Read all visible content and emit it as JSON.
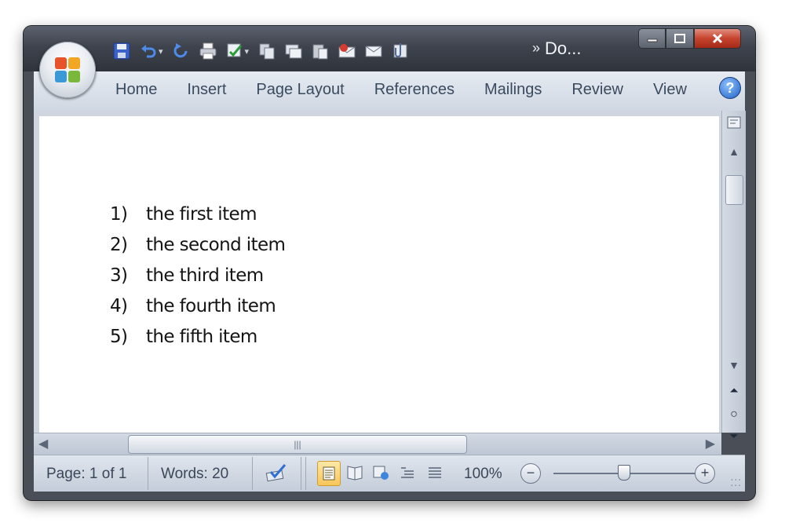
{
  "window": {
    "title": "Do..."
  },
  "quick_access": {
    "icons": [
      "save-icon",
      "undo-icon",
      "redo-icon",
      "quick-print-icon",
      "spelling-icon",
      "copy-icon",
      "new-comment-icon",
      "paste-icon",
      "email-icon",
      "envelope-icon",
      "attach-icon"
    ],
    "overflow": "»"
  },
  "ribbon": {
    "tabs": [
      "Home",
      "Insert",
      "Page Layout",
      "References",
      "Mailings",
      "Review",
      "View"
    ],
    "help": "?"
  },
  "document": {
    "list": [
      {
        "num": "1)",
        "text": "the first item"
      },
      {
        "num": "2)",
        "text": "the second item"
      },
      {
        "num": "3)",
        "text": "the third item"
      },
      {
        "num": "4)",
        "text": "the fourth item"
      },
      {
        "num": "5)",
        "text": "the fifth item"
      }
    ]
  },
  "status": {
    "page": "Page: 1 of 1",
    "words": "Words: 20",
    "zoom": "100%",
    "zoom_fraction": 0.5
  },
  "colors": {
    "title_bar": "#3e434d",
    "ribbon": "#dde3eb",
    "active_view": "#f7c65a",
    "close_button": "#c6432d"
  }
}
